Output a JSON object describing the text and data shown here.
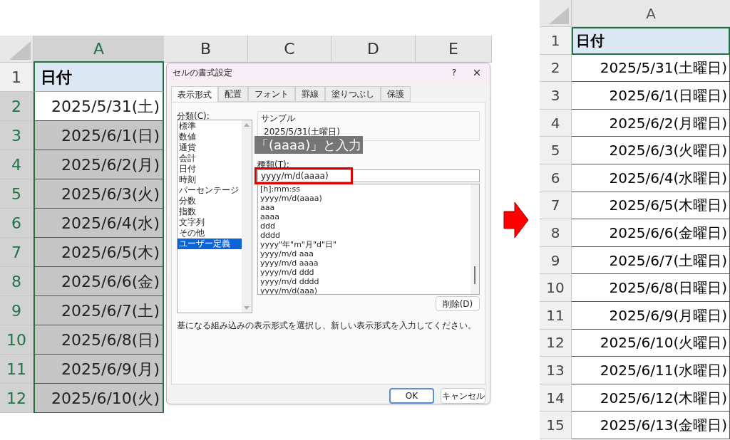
{
  "left_sheet": {
    "columns": [
      "A",
      "B",
      "C",
      "D",
      "E"
    ],
    "rows": [
      {
        "number": "1",
        "value": "日付",
        "kind": "header"
      },
      {
        "number": "2",
        "value": "2025/5/31(土)",
        "kind": "date",
        "selected": false
      },
      {
        "number": "3",
        "value": "2025/6/1(日)",
        "kind": "date",
        "selected": true
      },
      {
        "number": "4",
        "value": "2025/6/2(月)",
        "kind": "date",
        "selected": true
      },
      {
        "number": "5",
        "value": "2025/6/3(火)",
        "kind": "date",
        "selected": true
      },
      {
        "number": "6",
        "value": "2025/6/4(水)",
        "kind": "date",
        "selected": true
      },
      {
        "number": "7",
        "value": "2025/6/5(木)",
        "kind": "date",
        "selected": true
      },
      {
        "number": "8",
        "value": "2025/6/6(金)",
        "kind": "date",
        "selected": true
      },
      {
        "number": "9",
        "value": "2025/6/7(土)",
        "kind": "date",
        "selected": true
      },
      {
        "number": "10",
        "value": "2025/6/8(日)",
        "kind": "date",
        "selected": true
      },
      {
        "number": "11",
        "value": "2025/6/9(月)",
        "kind": "date",
        "selected": true
      },
      {
        "number": "12",
        "value": "2025/6/10(火)",
        "kind": "date",
        "selected": true
      }
    ]
  },
  "dialog": {
    "title": "セルの書式設定",
    "help": "?",
    "tabs": [
      {
        "label": "表示形式",
        "selected": true
      },
      {
        "label": "配置",
        "selected": false
      },
      {
        "label": "フォント",
        "selected": false
      },
      {
        "label": "罫線",
        "selected": false
      },
      {
        "label": "塗りつぶし",
        "selected": false
      },
      {
        "label": "保護",
        "selected": false
      }
    ],
    "category_label": "分類(C):",
    "categories": [
      {
        "label": "標準",
        "selected": false
      },
      {
        "label": "数値",
        "selected": false
      },
      {
        "label": "通貨",
        "selected": false
      },
      {
        "label": "会計",
        "selected": false
      },
      {
        "label": "日付",
        "selected": false
      },
      {
        "label": "時刻",
        "selected": false
      },
      {
        "label": "パーセンテージ",
        "selected": false
      },
      {
        "label": "分数",
        "selected": false
      },
      {
        "label": "指数",
        "selected": false
      },
      {
        "label": "文字列",
        "selected": false
      },
      {
        "label": "その他",
        "selected": false
      },
      {
        "label": "ユーザー定義",
        "selected": true
      }
    ],
    "sample_label": "サンプル",
    "sample_value": "2025/5/31(土曜日)",
    "caption": "「(aaaa)」と入力",
    "type_label": "種類(T):",
    "type_value": "yyyy/m/d(aaaa)",
    "formats": [
      "[h]:mm:ss",
      "yyyy/m/d(aaaa)",
      "aaa",
      "aaaa",
      "ddd",
      "dddd",
      "yyyy\"年\"m\"月\"d\"日\"",
      "yyyy/m/d aaa",
      "yyyy/m/d aaaa",
      "yyyy/m/d ddd",
      "yyyy/m/d dddd",
      "yyyy/m/d(aaa)"
    ],
    "delete_button": "削除(D)",
    "description": "基になる組み込みの表示形式を選択し、新しい表示形式を入力してください。",
    "ok_button": "OK",
    "cancel_button": "キャンセル"
  },
  "right_sheet": {
    "column": "A",
    "rows": [
      {
        "number": "1",
        "value": "日付",
        "kind": "header"
      },
      {
        "number": "2",
        "value": "2025/5/31(土曜日)",
        "kind": "date"
      },
      {
        "number": "3",
        "value": "2025/6/1(日曜日)",
        "kind": "date"
      },
      {
        "number": "4",
        "value": "2025/6/2(月曜日)",
        "kind": "date"
      },
      {
        "number": "5",
        "value": "2025/6/3(火曜日)",
        "kind": "date"
      },
      {
        "number": "6",
        "value": "2025/6/4(水曜日)",
        "kind": "date"
      },
      {
        "number": "7",
        "value": "2025/6/5(木曜日)",
        "kind": "date"
      },
      {
        "number": "8",
        "value": "2025/6/6(金曜日)",
        "kind": "date"
      },
      {
        "number": "9",
        "value": "2025/6/7(土曜日)",
        "kind": "date"
      },
      {
        "number": "10",
        "value": "2025/6/8(日曜日)",
        "kind": "date"
      },
      {
        "number": "11",
        "value": "2025/6/9(月曜日)",
        "kind": "date"
      },
      {
        "number": "12",
        "value": "2025/6/10(火曜日)",
        "kind": "date"
      },
      {
        "number": "13",
        "value": "2025/6/11(水曜日)",
        "kind": "date"
      },
      {
        "number": "14",
        "value": "2025/6/12(木曜日)",
        "kind": "date"
      },
      {
        "number": "15",
        "value": "2025/6/13(金曜日)",
        "kind": "date"
      }
    ]
  }
}
